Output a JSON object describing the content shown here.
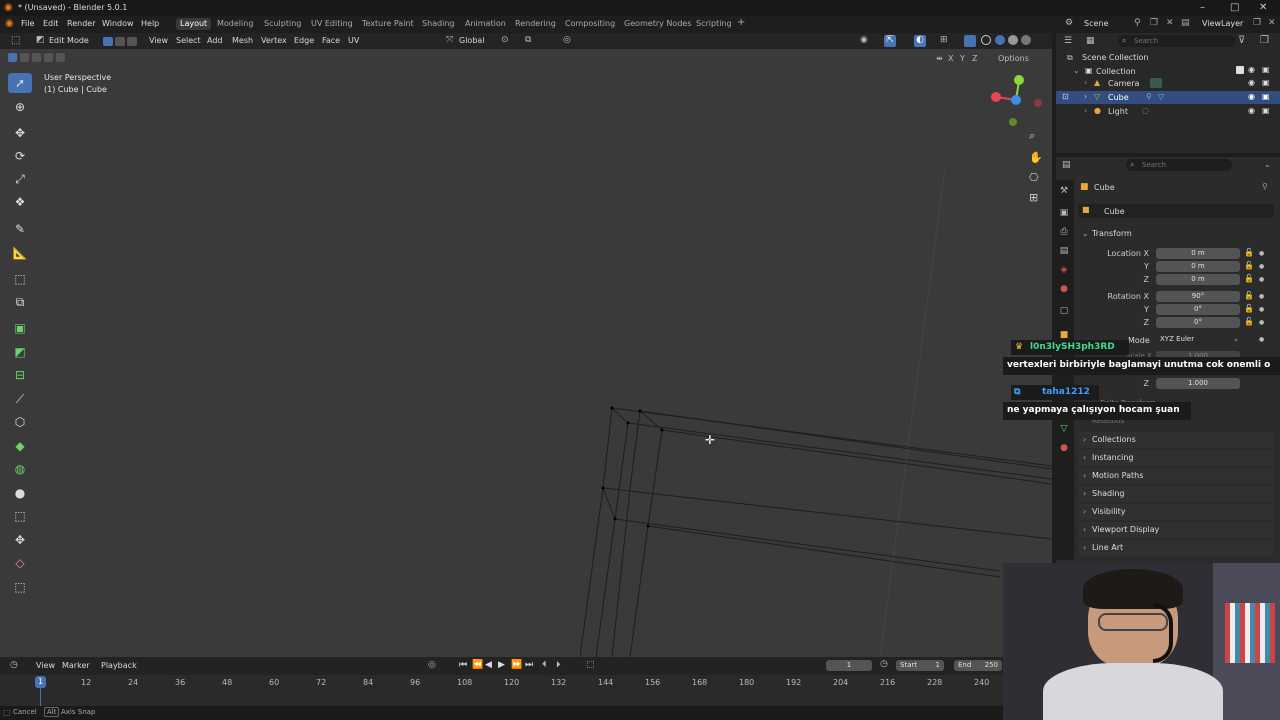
{
  "titlebar": {
    "title": "* (Unsaved) - Blender 5.0.1",
    "min": "–",
    "max": "□",
    "close": "✕"
  },
  "menu": [
    "File",
    "Edit",
    "Render",
    "Window",
    "Help"
  ],
  "workspaces": [
    "Layout",
    "Modeling",
    "Sculpting",
    "UV Editing",
    "Texture Paint",
    "Shading",
    "Animation",
    "Rendering",
    "Compositing",
    "Geometry Nodes",
    "Scripting"
  ],
  "add_workspace": "+",
  "scene": {
    "label": "Scene",
    "viewlayer": "ViewLayer"
  },
  "viewport_header": {
    "mode": "Edit Mode",
    "menus": [
      "View",
      "Select",
      "Add",
      "Mesh",
      "Vertex",
      "Edge",
      "Face",
      "UV"
    ],
    "orientation": "Global",
    "options": "Options"
  },
  "overlay": {
    "view": "User Perspective",
    "object": "(1) Cube | Cube"
  },
  "axes": {
    "x": "X",
    "y": "Y",
    "z": "Z"
  },
  "outliner": {
    "search": "Search",
    "root": "Scene Collection",
    "collection": "Collection",
    "items": [
      "Camera",
      "Cube",
      "Light"
    ]
  },
  "properties": {
    "search": "Search",
    "object_name": "Cube",
    "datablock": "Cube",
    "transform": "Transform",
    "location_label": "Location X",
    "loc": [
      "0 m",
      "0 m",
      "0 m"
    ],
    "rotation_label": "Rotation X",
    "rot": [
      "90°",
      "0°",
      "0°"
    ],
    "y": "Y",
    "z": "Z",
    "mode_label": "Mode",
    "mode_value": "XYZ Euler",
    "scale_partial": "Scale X",
    "scale_partial_value": "1.000",
    "scale_z_value": "1.000",
    "delta": "Delta Transform",
    "relations": "Relations",
    "sections": [
      "Collections",
      "Instancing",
      "Motion Paths",
      "Shading",
      "Visibility",
      "Viewport Display",
      "Line Art"
    ]
  },
  "chat": [
    {
      "user": "l0n3lySH3ph3RD",
      "message": "vertexleri birbiriyle baglamayi unutma cok onemli o",
      "user_color": "#3fdc8e"
    },
    {
      "user": "taha1212",
      "message": "ne yapmaya çalışıyon hocam şuan",
      "user_color": "#3aa0ff"
    }
  ],
  "timeline": {
    "menus": [
      "View",
      "Marker",
      "Playback"
    ],
    "current_frame": "1",
    "start_label": "Start",
    "start": "1",
    "end_label": "End",
    "end": "250",
    "ticks": [
      "1",
      "12",
      "24",
      "36",
      "48",
      "60",
      "72",
      "84",
      "96",
      "108",
      "120",
      "132",
      "144",
      "156",
      "168",
      "180",
      "192",
      "204",
      "216",
      "228",
      "240"
    ],
    "playhead_frame": 1
  },
  "statusbar": {
    "cancel": "Cancel",
    "alt": "Alt",
    "axis_snap": "Axis Snap"
  },
  "colors": {
    "accent": "#4772b3",
    "x_axis": "#e74558",
    "y_axis": "#8bd93c",
    "z_axis": "#3a8ee8",
    "selected": "#334d80"
  }
}
